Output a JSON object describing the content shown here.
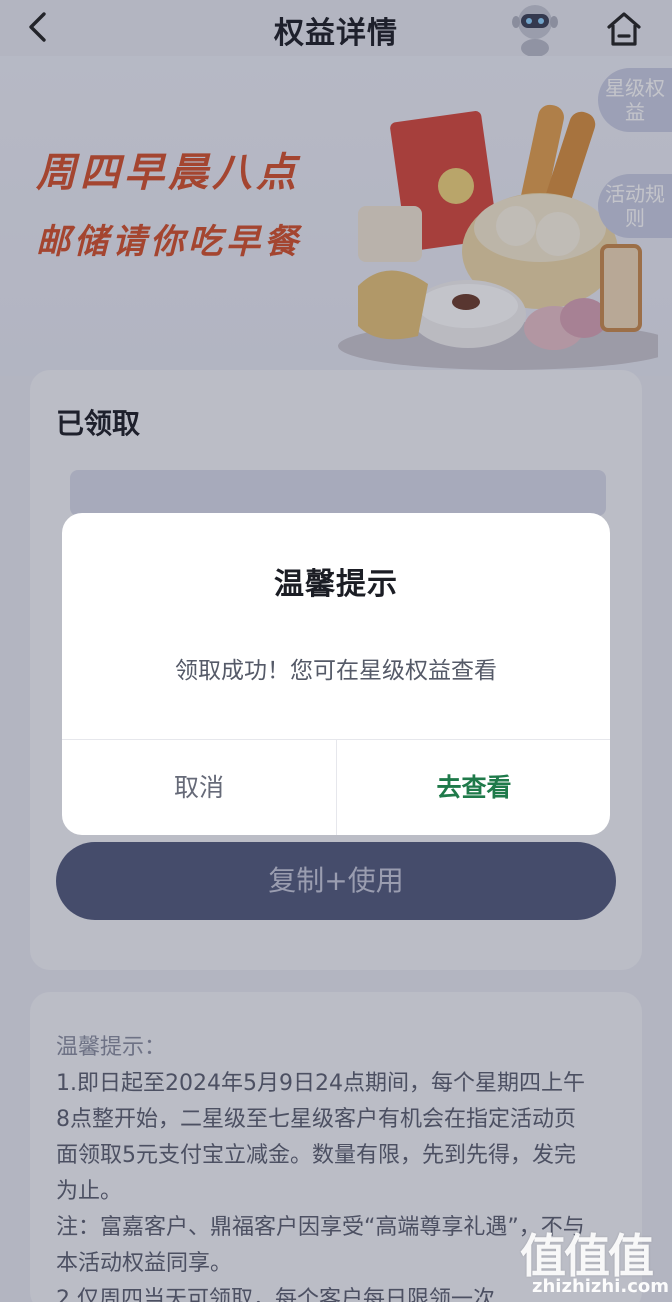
{
  "header": {
    "title": "权益详情",
    "back_icon": "chevron-left-icon",
    "robot_icon": "robot-assistant-icon",
    "home_icon": "home-icon"
  },
  "banner": {
    "line1": "周四早晨八点",
    "line2": "邮储请你吃早餐",
    "side_tabs": [
      {
        "label": "星级权益"
      },
      {
        "label": "活动规则"
      }
    ]
  },
  "main": {
    "received_title": "已领取",
    "copy_use_label": "复制+使用"
  },
  "notes": {
    "heading": "温馨提示：",
    "lines": [
      "1.即日起至2024年5月9日24点期间，每个星期四上午",
      "8点整开始，二星级至七星级客户有机会在指定活动页",
      "面领取5元支付宝立减金。数量有限，先到先得，发完",
      "为止。",
      "注：富嘉客户、鼎福客户因享受“高端尊享礼遇”，不与",
      "本活动权益同享。",
      "2.仅周四当天可领取，每个客户每日限领一次"
    ]
  },
  "dialog": {
    "title": "温馨提示",
    "message": "领取成功！您可在星级权益查看",
    "cancel_label": "取消",
    "confirm_label": "去查看"
  },
  "watermark": {
    "logo": "值值值",
    "url": "zhizhizhi.com"
  },
  "colors": {
    "banner_text": "#d4502a",
    "primary_button": "#51597c",
    "confirm_text": "#1f7a4a",
    "overlay": "rgba(40,44,64,0.28)"
  }
}
